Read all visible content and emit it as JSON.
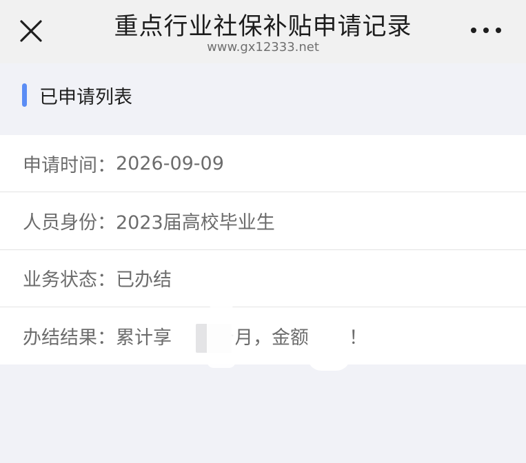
{
  "header": {
    "title": "重点行业社保补贴申请记录",
    "url": "www.gx12333.net",
    "close_icon": "close-icon",
    "more_icon": "more-icon"
  },
  "section": {
    "title": "已申请列表",
    "accent_color": "#5b8df5"
  },
  "records": [
    {
      "label": "申请时间：",
      "value": "2026-09-09"
    },
    {
      "label": "人员身份：",
      "value": "2023届高校毕业生"
    },
    {
      "label": "业务状态：",
      "value": "已办结"
    },
    {
      "label": "办结结果：",
      "value_parts": [
        "累计享",
        "个月，金额",
        "！"
      ]
    }
  ]
}
